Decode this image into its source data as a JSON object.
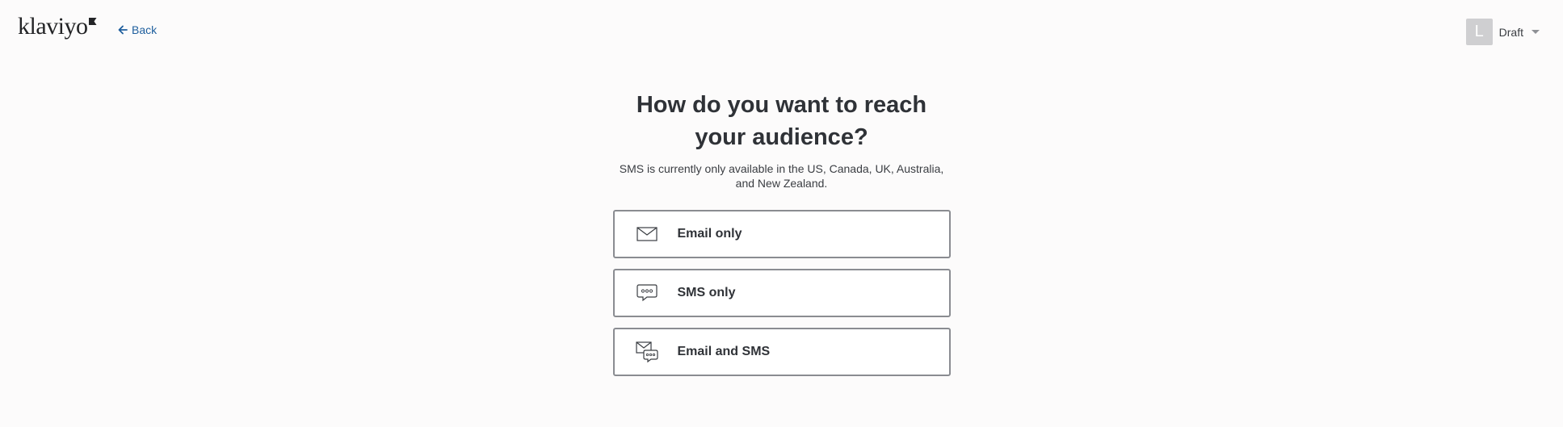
{
  "header": {
    "logo_text": "klaviyo",
    "back_label": "Back",
    "avatar_initial": "L",
    "status_label": "Draft"
  },
  "main": {
    "heading": "How do you want to reach your audience?",
    "subtext": "SMS is currently only available in the US, Canada, UK, Australia, and New Zealand.",
    "options": [
      {
        "label": "Email only",
        "icon": "envelope-icon"
      },
      {
        "label": "SMS only",
        "icon": "chat-bubble-icon"
      },
      {
        "label": "Email and SMS",
        "icon": "envelope-chat-icon"
      }
    ]
  },
  "colors": {
    "link": "#1f5f9e",
    "text": "#2f3237",
    "option_border": "#8a8c91",
    "avatar_bg": "#cfcfd1",
    "background": "#fcfbfb"
  }
}
